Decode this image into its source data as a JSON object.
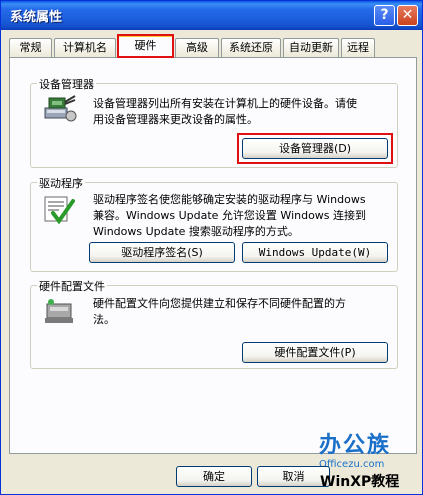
{
  "window": {
    "title": "系统属性"
  },
  "title_buttons": {
    "help": "?",
    "close": "✕"
  },
  "tabs": [
    {
      "label": "常规"
    },
    {
      "label": "计算机名"
    },
    {
      "label": "硬件"
    },
    {
      "label": "高级"
    },
    {
      "label": "系统还原"
    },
    {
      "label": "自动更新"
    },
    {
      "label": "远程"
    }
  ],
  "active_tab": "硬件",
  "device_manager": {
    "heading": "设备管理器",
    "line1": "设备管理器列出所有安装在计算机上的硬件设备。请使",
    "line2": "用设备管理器来更改设备的属性。",
    "button": "设备管理器(D)"
  },
  "drivers": {
    "heading": "驱动程序",
    "line1": "驱动程序签名使您能够确定安装的驱动程序与 Windows",
    "line2": "兼容。Windows Update 允许您设置 Windows 连接到",
    "line3": "Windows Update 搜索驱动程序的方式。",
    "signing_button": "驱动程序签名(S)",
    "update_button": "Windows Update(W)"
  },
  "hardware_profiles": {
    "heading": "硬件配置文件",
    "line1": "硬件配置文件向您提供建立和保存不同硬件配置的方",
    "line2": "法。",
    "button": "硬件配置文件(P)"
  },
  "footer": {
    "ok": "确定",
    "cancel": "取消"
  },
  "watermark": {
    "brand": "办公族",
    "site": "Officezu.com",
    "corner": "WinXP教程"
  },
  "colors": {
    "title_blue": "#2369e8",
    "highlight_red": "#e01010",
    "tab_accent": "#ffc73c"
  }
}
